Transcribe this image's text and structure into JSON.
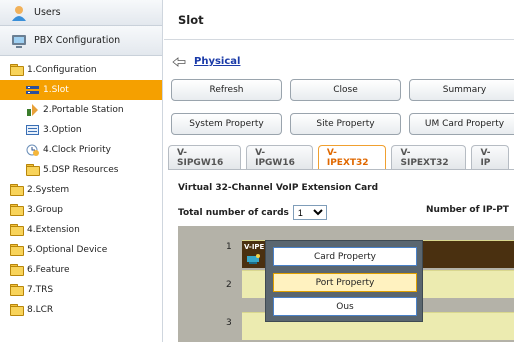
{
  "sidebar": {
    "header_users": "Users",
    "header_pbx": "PBX Configuration",
    "items": [
      {
        "label": "1.Configuration",
        "level": 1
      },
      {
        "label": "1.Slot",
        "level": 2,
        "selected": true
      },
      {
        "label": "2.Portable Station",
        "level": 2
      },
      {
        "label": "3.Option",
        "level": 2
      },
      {
        "label": "4.Clock Priority",
        "level": 2
      },
      {
        "label": "5.DSP Resources",
        "level": 2
      },
      {
        "label": "2.System",
        "level": 1
      },
      {
        "label": "3.Group",
        "level": 1
      },
      {
        "label": "4.Extension",
        "level": 1
      },
      {
        "label": "5.Optional Device",
        "level": 1
      },
      {
        "label": "6.Feature",
        "level": 1
      },
      {
        "label": "7.TRS",
        "level": 1
      },
      {
        "label": "8.LCR",
        "level": 1
      }
    ]
  },
  "main": {
    "title": "Slot",
    "breadcrumb": "Physical",
    "buttons_row1": [
      "Refresh",
      "Close",
      "Summary"
    ],
    "buttons_row2": [
      "System Property",
      "Site Property",
      "UM Card Property"
    ],
    "tabs": [
      "V-SIPGW16",
      "V-IPGW16",
      "V-IPEXT32",
      "V-SIPEXT32",
      "V-IP"
    ],
    "active_tab": "V-IPEXT32",
    "card_title": "Virtual 32-Channel VoIP Extension Card",
    "total_label": "Total number of cards",
    "total_value": "1",
    "ip_label": "Number of IP-PT",
    "slots": [
      "1",
      "2",
      "3"
    ],
    "slot1_tag": "V-IPE",
    "context_menu": [
      "Card Property",
      "Port Property",
      "Ous"
    ]
  },
  "colors": {
    "selected": "#f5a000",
    "active_tab": "#e06800",
    "link": "#1a3aa8"
  }
}
